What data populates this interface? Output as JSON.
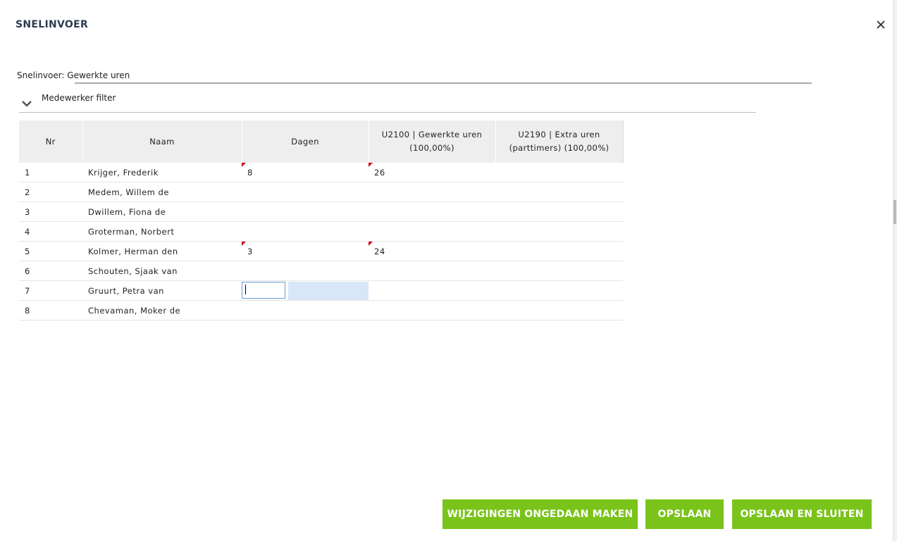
{
  "dialog": {
    "title": "SNELINVOER"
  },
  "section": {
    "label": "Snelinvoer: Gewerkte uren"
  },
  "filter": {
    "label": "Medewerker filter",
    "icon": "chevron-down-icon"
  },
  "table": {
    "headers": {
      "nr": "Nr",
      "naam": "Naam",
      "dagen": "Dagen",
      "u2100_line1": "U2100 | Gewerkte uren",
      "u2100_line2": "(100,00%)",
      "u2190_line1": "U2190 | Extra uren",
      "u2190_line2": "(parttimers) (100,00%)"
    },
    "rows": [
      {
        "nr": "1",
        "naam": "Krijger, Frederik",
        "dagen": "8",
        "u2100": "26",
        "u2190": ""
      },
      {
        "nr": "2",
        "naam": "Medem, Willem de",
        "dagen": "",
        "u2100": "",
        "u2190": ""
      },
      {
        "nr": "3",
        "naam": "Dwillem, Fiona de",
        "dagen": "",
        "u2100": "",
        "u2190": ""
      },
      {
        "nr": "4",
        "naam": "Groterman, Norbert",
        "dagen": "",
        "u2100": "",
        "u2190": ""
      },
      {
        "nr": "5",
        "naam": "Kolmer, Herman den",
        "dagen": "3",
        "u2100": "24",
        "u2190": ""
      },
      {
        "nr": "6",
        "naam": "Schouten, Sjaak van",
        "dagen": "",
        "u2100": "",
        "u2190": ""
      },
      {
        "nr": "7",
        "naam": "Gruurt, Petra van",
        "dagen": "",
        "u2100": "",
        "u2190": ""
      },
      {
        "nr": "8",
        "naam": "Chevaman, Moker de",
        "dagen": "",
        "u2100": "",
        "u2190": ""
      }
    ]
  },
  "buttons": {
    "undo": "WIJZIGINGEN ONGEDAAN MAKEN",
    "save": "OPSLAAN",
    "save_close": "OPSLAAN EN SLUITEN"
  },
  "colors": {
    "accent": "#7ac31a",
    "title": "#2c3e50",
    "change_marker": "#d0021b",
    "selection": "#d9e6f7"
  }
}
